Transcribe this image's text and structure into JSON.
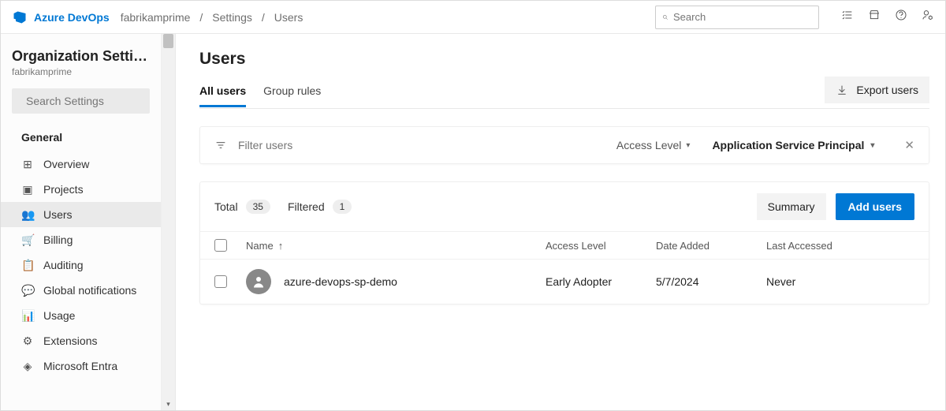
{
  "header": {
    "brand": "Azure DevOps",
    "breadcrumbs": [
      "fabrikamprime",
      "Settings",
      "Users"
    ],
    "search_placeholder": "Search"
  },
  "sidebar": {
    "title": "Organization Settin…",
    "subtitle": "fabrikamprime",
    "search_placeholder": "Search Settings",
    "section": "General",
    "items": [
      {
        "icon": "⊞",
        "label": "Overview"
      },
      {
        "icon": "▣",
        "label": "Projects"
      },
      {
        "icon": "👥",
        "label": "Users"
      },
      {
        "icon": "🛒",
        "label": "Billing"
      },
      {
        "icon": "📋",
        "label": "Auditing"
      },
      {
        "icon": "💬",
        "label": "Global notifications"
      },
      {
        "icon": "📊",
        "label": "Usage"
      },
      {
        "icon": "⚙",
        "label": "Extensions"
      },
      {
        "icon": "◈",
        "label": "Microsoft Entra"
      }
    ],
    "selected_index": 2
  },
  "main": {
    "title": "Users",
    "tabs": [
      {
        "label": "All users",
        "active": true
      },
      {
        "label": "Group rules",
        "active": false
      }
    ],
    "export_label": "Export users",
    "filter": {
      "placeholder": "Filter users",
      "access_level_label": "Access Level",
      "applied_value": "Application Service Principal"
    },
    "counts": {
      "total_label": "Total",
      "total_value": "35",
      "filtered_label": "Filtered",
      "filtered_value": "1"
    },
    "summary_label": "Summary",
    "add_label": "Add users",
    "columns": {
      "name": "Name",
      "access": "Access Level",
      "date": "Date Added",
      "last": "Last Accessed",
      "sort_icon": "↑"
    },
    "rows": [
      {
        "name": "azure-devops-sp-demo",
        "access": "Early Adopter",
        "date": "5/7/2024",
        "last": "Never"
      }
    ]
  }
}
